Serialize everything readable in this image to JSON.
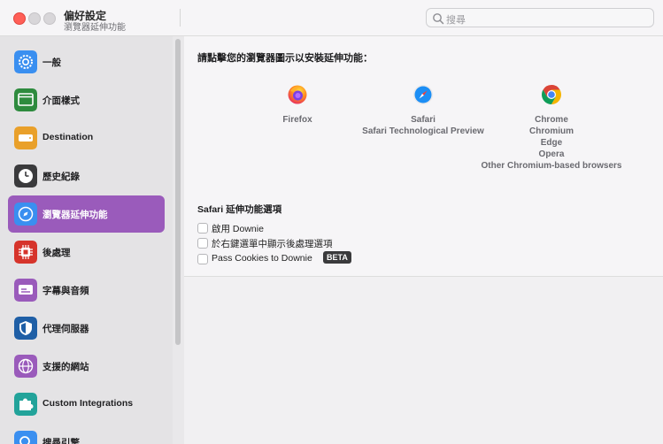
{
  "window": {
    "title": "偏好設定",
    "subtitle": "瀏覽器延伸功能"
  },
  "search": {
    "placeholder": "搜尋"
  },
  "sidebar": {
    "items": [
      {
        "label": "一般",
        "icon": "gear-icon",
        "color": "#3a8ff0"
      },
      {
        "label": "介面樣式",
        "icon": "window-icon",
        "color": "#2e8b3e"
      },
      {
        "label": "Destination",
        "icon": "drive-icon",
        "color": "#e9a02a"
      },
      {
        "label": "歷史紀錄",
        "icon": "clock-icon",
        "color": "#3a3a3c"
      },
      {
        "label": "瀏覽器延伸功能",
        "icon": "compass-icon",
        "color": "#3a8ff0",
        "active": true
      },
      {
        "label": "後處理",
        "icon": "chip-icon",
        "color": "#d6342b"
      },
      {
        "label": "字幕與音頻",
        "icon": "subtitles-icon",
        "color": "#9a5bbb"
      },
      {
        "label": "代理伺服器",
        "icon": "shield-icon",
        "color": "#1f5fa6"
      },
      {
        "label": "支援的網站",
        "icon": "globe-icon",
        "color": "#9a5bbb"
      },
      {
        "label": "Custom Integrations",
        "icon": "puzzle-icon",
        "color": "#22a39a"
      },
      {
        "label": "搜尋引擎",
        "icon": "search-icon",
        "color": "#3a8ff0"
      }
    ]
  },
  "main": {
    "heading": "請點擊您的瀏覽器圖示以安裝延伸功能：",
    "browsers": {
      "firefox": {
        "names": [
          "Firefox"
        ],
        "icon": "firefox-icon"
      },
      "safari": {
        "names": [
          "Safari",
          "Safari Technological Preview"
        ],
        "icon": "safari-icon"
      },
      "chrome": {
        "names": [
          "Chrome",
          "Chromium",
          "Edge",
          "Opera",
          "Other Chromium-based browsers"
        ],
        "icon": "chrome-icon"
      }
    },
    "safari_options": {
      "heading": "Safari 延伸功能選項",
      "options": [
        {
          "label": "啟用 Downie",
          "checked": false
        },
        {
          "label": "於右鍵選單中顯示後處理選項",
          "checked": false
        },
        {
          "label": "Pass Cookies to Downie",
          "checked": false,
          "badge": "BETA"
        }
      ]
    }
  }
}
